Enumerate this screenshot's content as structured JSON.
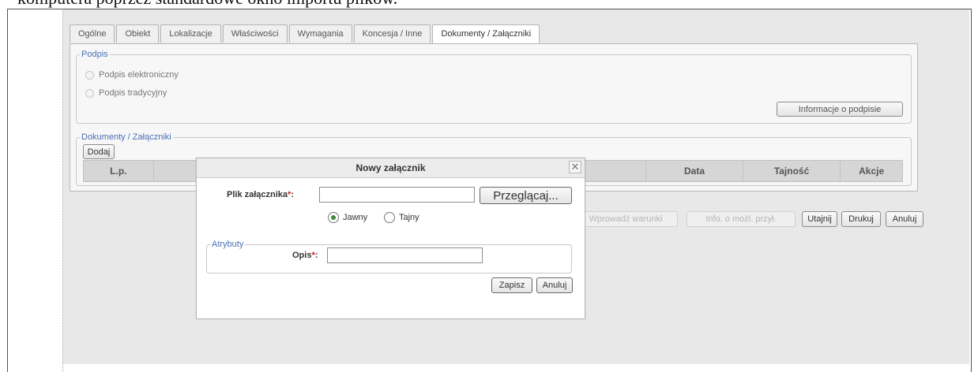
{
  "document": {
    "top_text": "komputera poprzez standardowe okno importu plików."
  },
  "tabs": [
    {
      "label": "Ogólne",
      "active": false
    },
    {
      "label": "Obiekt",
      "active": false
    },
    {
      "label": "Lokalizacje",
      "active": false
    },
    {
      "label": "Właściwości",
      "active": false
    },
    {
      "label": "Wymagania",
      "active": false
    },
    {
      "label": "Koncesja / Inne",
      "active": false
    },
    {
      "label": "Dokumenty / Załączniki",
      "active": true
    }
  ],
  "podpis": {
    "legend": "Podpis",
    "option1": "Podpis elektroniczny",
    "option2": "Podpis tradycyjny",
    "info_button": "Informacje o podpisie"
  },
  "dokumenty": {
    "legend": "Dokumenty / Załączniki",
    "add_button": "Dodaj",
    "columns": {
      "lp": "L.p.",
      "data": "Data",
      "tajnosc": "Tajność",
      "akcje": "Akcje"
    }
  },
  "bottom_buttons": {
    "wprowadz": "Wprowadź warunki",
    "info": "Info. o możl. przył.",
    "utajnij": "Utajnij",
    "drukuj": "Drukuj",
    "anuluj": "Anuluj"
  },
  "modal": {
    "title": "Nowy załącznik",
    "close_glyph": "✕",
    "file_label": "Plik załącznika",
    "file_value": "",
    "browse_button": "Przeglącaj...",
    "radio_jawny": "Jawny",
    "radio_tajny": "Tajny",
    "selected": "Jawny",
    "attributes_legend": "Atrybuty",
    "opis_label": "Opis",
    "opis_value": "",
    "required_mark": "*",
    "colon": ":",
    "save_button": "Zapisz",
    "cancel_button": "Anuluj"
  }
}
